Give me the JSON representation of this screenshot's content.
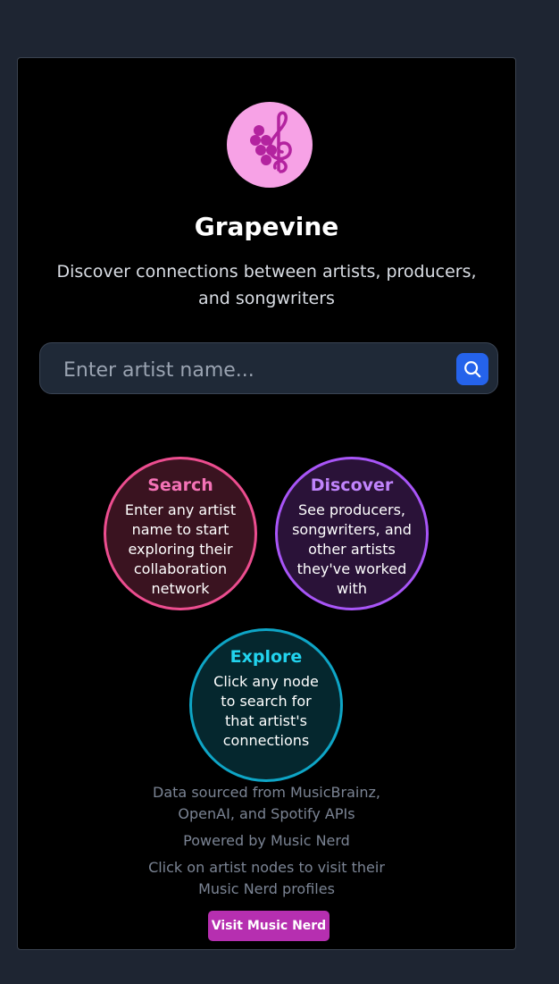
{
  "app": {
    "logo_icon": "grape-treble-clef-icon",
    "title": "Grapevine",
    "subtitle": "Discover connections between artists, producers, and songwriters"
  },
  "search": {
    "placeholder": "Enter artist name...",
    "value": "",
    "button_icon": "search-icon"
  },
  "features": {
    "search": {
      "title": "Search",
      "text": "Enter any artist name to start exploring their collaboration network",
      "color": "#ec4d8f"
    },
    "discover": {
      "title": "Discover",
      "text": "See producers, songwriters, and other artists they've worked with",
      "color": "#a855f7"
    },
    "explore": {
      "title": "Explore",
      "text": "Click any node to search for that artist's connections",
      "color": "#0ea5c6"
    }
  },
  "footer": {
    "data_source": "Data sourced from MusicBrainz, OpenAI, and Spotify APIs",
    "powered_by": "Powered by Music Nerd",
    "click_hint": "Click on artist nodes to visit their Music Nerd profiles",
    "visit_label": "Visit Music Nerd"
  },
  "colors": {
    "accent_blue": "#2563eb",
    "logo_bg": "#f7a2e6",
    "visit_button": "#b62fb0"
  }
}
